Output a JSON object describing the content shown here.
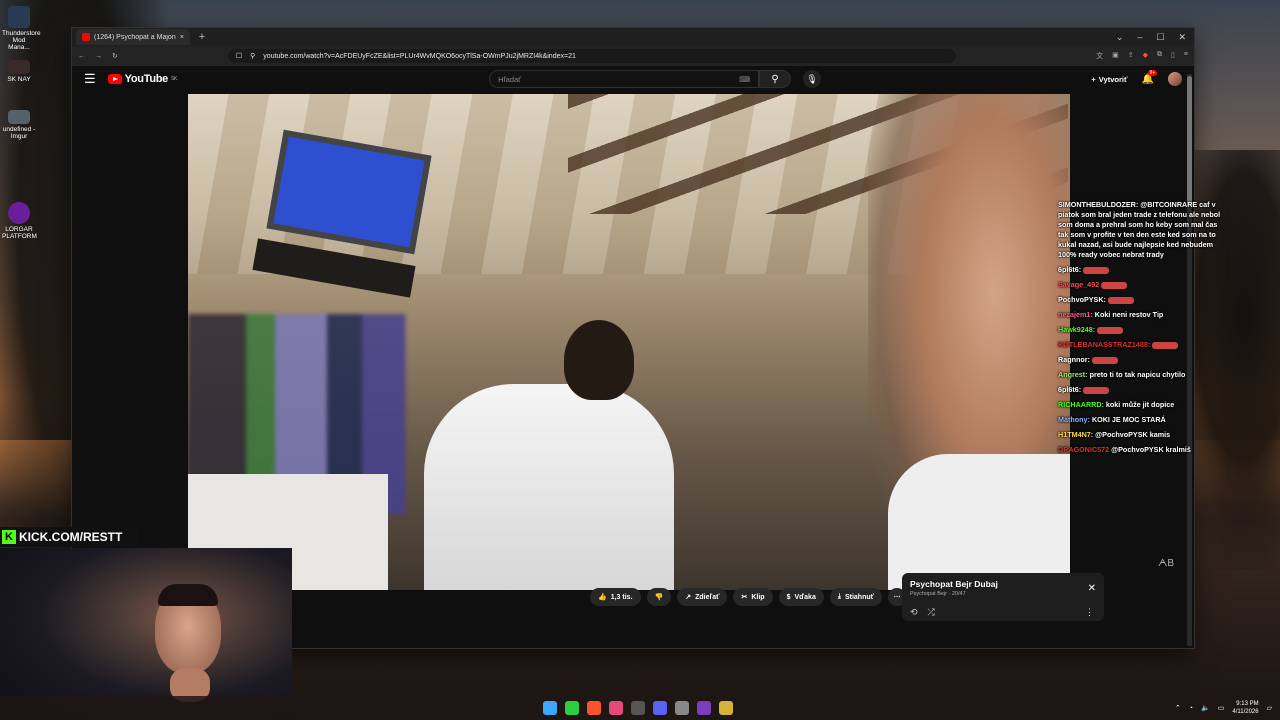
{
  "desktop": {
    "icons": [
      {
        "label": "Thunderstore Mod Mana..."
      },
      {
        "label": "SK NAY"
      },
      {
        "label": "undefined - Imgur"
      },
      {
        "label": "LORGAR PLATFORM"
      }
    ]
  },
  "browser": {
    "tab_title": "(1264) Psychopat a Majoner...",
    "url": "youtube.com/watch?v=AcFDEUyFcZE&list=PLUr4WvMQKO6ocyTlSa-OWmPJu2jMRZI4k&index=21"
  },
  "youtube": {
    "logo": "YouTube",
    "country": "SK",
    "search_placeholder": "Hľadať",
    "create_label": "Vytvoriť",
    "notif_count": "9+",
    "video_watermark": "ᗅB",
    "actions": {
      "likes": "1,3 tis.",
      "share": "Zdieľať",
      "clip": "Klip",
      "thanks": "Vďaka",
      "download": "Stiahnuť"
    },
    "mix": {
      "title": "Psychopat Bejr  Dubaj",
      "subtitle": "Psychopat Bejr - 20/47"
    }
  },
  "chat": [
    {
      "user": "SIMONTHEBULDOZER:",
      "color": "#ffffff",
      "text": "@BITCOINRARE caf v piatok som bral jeden trade z telefonu ale nebol som doma a prehral som ho keby som mal čas tak som v profite v ten den este ked som na to kukal nazad, asi bude najlepsie ked nebudem 100% ready vobec nebrat trady"
    },
    {
      "user": "6pl6t6:",
      "color": "#ffffff",
      "text": ""
    },
    {
      "user": "Savage_492",
      "color": "#ff4b4b",
      "text": ""
    },
    {
      "user": "PochvoPYSK:",
      "color": "#ffffff",
      "text": ""
    },
    {
      "user": "nezajem1:",
      "color": "#ff5a8a",
      "text": "Koki neni restov Tip"
    },
    {
      "user": "Hawk9248:",
      "color": "#53fc18",
      "text": ""
    },
    {
      "user": "KOTLEBANASSTRAZ1488:",
      "color": "#e03030",
      "text": ""
    },
    {
      "user": "Ragnnor:",
      "color": "#ffffff",
      "text": ""
    },
    {
      "user": "Angrest:",
      "color": "#9fe870",
      "text": "preto ti to tak napicu chytilo"
    },
    {
      "user": "6pl6t6:",
      "color": "#ffffff",
      "text": ""
    },
    {
      "user": "RICHAARRD:",
      "color": "#53fc18",
      "text": "koki může jit dopice"
    },
    {
      "user": "Mathony:",
      "color": "#8ab4ff",
      "text": "KOKI JE MOC STARÁ"
    },
    {
      "user": "H1TM4N7:",
      "color": "#ffd84b",
      "text": "@PochvoPYSK kamis"
    },
    {
      "user": "DRAGONIC572",
      "color": "#e03030",
      "text": "@PochvoPYSK kralmiš"
    }
  ],
  "stream": {
    "kick_label": "KICK.COM/RESTT"
  },
  "taskbar": {
    "time": "9:13 PM",
    "date": "4/11/2026"
  },
  "colors": {
    "kick_green": "#53fc18",
    "youtube_red": "#ff0000"
  }
}
